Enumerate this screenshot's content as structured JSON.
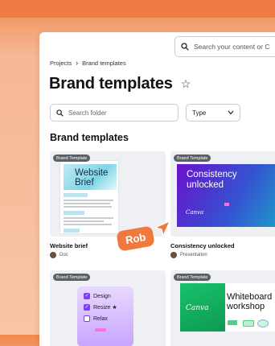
{
  "header": {
    "search_placeholder": "Search your content or C",
    "breadcrumb": [
      "Projects",
      "Brand templates"
    ],
    "title": "Brand templates"
  },
  "toolbar": {
    "search_folder_placeholder": "Search folder",
    "type_label": "Type"
  },
  "section_title": "Brand templates",
  "cards": [
    {
      "badge": "Brand Template",
      "thumb_title": "Website Brief",
      "thumb_line1": "Website",
      "thumb_line2": "Brief",
      "name": "Website brief",
      "kind": "Doc"
    },
    {
      "badge": "Brand Template",
      "thumb_line1": "Consistency",
      "thumb_line2": "unlocked",
      "thumb_brand": "Canva",
      "name": "Consistency unlocked",
      "kind": "Presentation"
    },
    {
      "badge": "Brand Template",
      "items": [
        "Design",
        "Resize ★",
        "Relax"
      ]
    },
    {
      "badge": "Brand Template",
      "thumb_brand": "Canva",
      "thumb_line1": "Whiteboard",
      "thumb_line2": "workshop"
    }
  ],
  "cursor_label": "Rob",
  "colors": {
    "accent_orange": "#f07a3e",
    "purple": "#7b3ff2"
  }
}
